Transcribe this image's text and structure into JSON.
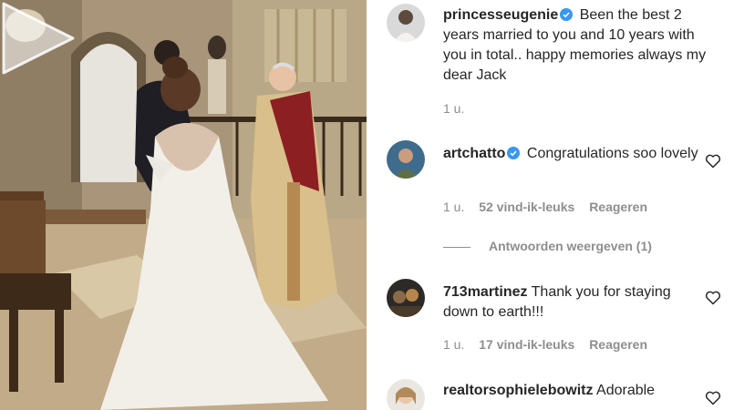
{
  "post": {
    "play_icon": "play-icon",
    "caption": {
      "username": "princesseugenie",
      "verified": true,
      "text": "Been the best 2 years married to you and 10 years with you in total.. happy memories always my dear Jack",
      "time": "1 u."
    }
  },
  "comments": [
    {
      "username": "artchatto",
      "verified": true,
      "text": "Congratulations soo lovely",
      "time": "1 u.",
      "likes": "52 vind-ik-leuks",
      "reply_label": "Reageren",
      "view_replies": "Antwoorden weergeven (1)"
    },
    {
      "username": "713martinez",
      "verified": false,
      "text": "Thank you for staying down to earth!!!",
      "time": "1 u.",
      "likes": "17 vind-ik-leuks",
      "reply_label": "Reageren"
    },
    {
      "username": "realtorsophielebowitz",
      "verified": false,
      "text": "Adorable"
    }
  ],
  "colors": {
    "verified_blue": "#3897f0",
    "meta_gray": "#8e8e8e",
    "text": "#262626"
  }
}
